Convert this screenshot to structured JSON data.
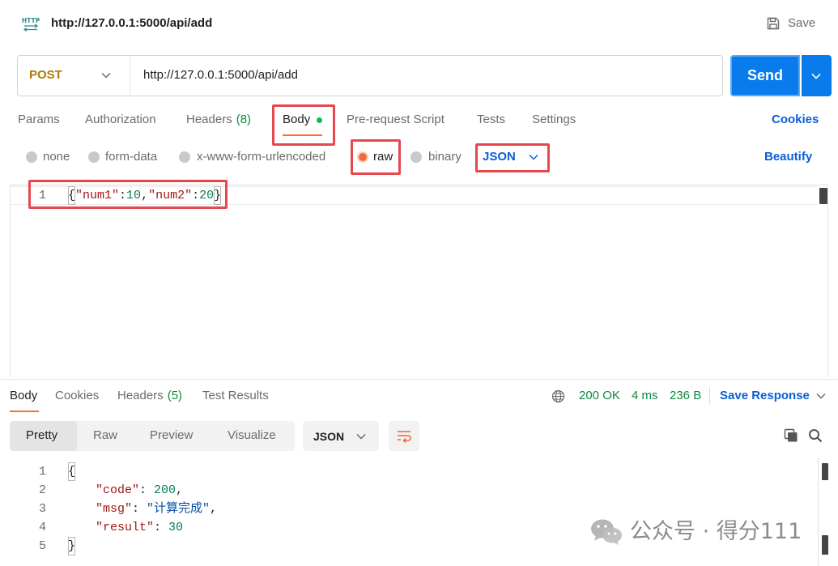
{
  "header": {
    "icon_text": "HTTP",
    "title": "http://127.0.0.1:5000/api/add",
    "save_label": "Save"
  },
  "request": {
    "method": "POST",
    "url": "http://127.0.0.1:5000/api/add",
    "send_label": "Send"
  },
  "request_tabs": [
    {
      "label": "Params",
      "active": false
    },
    {
      "label": "Authorization",
      "active": false
    },
    {
      "label": "Headers",
      "count": "(8)",
      "active": false
    },
    {
      "label": "Body",
      "active": true,
      "has_content": true
    },
    {
      "label": "Pre-request Script",
      "active": false
    },
    {
      "label": "Tests",
      "active": false
    },
    {
      "label": "Settings",
      "active": false
    }
  ],
  "cookies_label": "Cookies",
  "body_options": {
    "types": [
      {
        "label": "none",
        "selected": false
      },
      {
        "label": "form-data",
        "selected": false
      },
      {
        "label": "x-www-form-urlencoded",
        "selected": false
      },
      {
        "label": "raw",
        "selected": true
      },
      {
        "label": "binary",
        "selected": false
      }
    ],
    "format": "JSON",
    "beautify_label": "Beautify"
  },
  "request_body": {
    "line_numbers": [
      "1"
    ],
    "lines": [
      [
        "{",
        "\"num1\"",
        ":",
        "10",
        ",",
        "\"num2\"",
        ":",
        "20",
        "}"
      ]
    ]
  },
  "response_tabs": [
    {
      "label": "Body",
      "active": true
    },
    {
      "label": "Cookies",
      "active": false
    },
    {
      "label": "Headers",
      "count": "(5)",
      "active": false
    },
    {
      "label": "Test Results",
      "active": false
    }
  ],
  "response_meta": {
    "status": "200 OK",
    "time": "4 ms",
    "size": "236 B",
    "save_response_label": "Save Response"
  },
  "response_view": {
    "modes": [
      {
        "label": "Pretty",
        "selected": true
      },
      {
        "label": "Raw",
        "selected": false
      },
      {
        "label": "Preview",
        "selected": false
      },
      {
        "label": "Visualize",
        "selected": false
      }
    ],
    "format": "JSON"
  },
  "response_body": {
    "line_numbers": [
      "1",
      "2",
      "3",
      "4",
      "5"
    ],
    "lines": [
      [
        "{"
      ],
      [
        "\"code\"",
        ": ",
        "200",
        ","
      ],
      [
        "\"msg\"",
        ": ",
        "\"计算完成\"",
        ","
      ],
      [
        "\"result\"",
        ": ",
        "30"
      ],
      [
        "}"
      ]
    ]
  },
  "watermark": {
    "text": "公众号 · 得分111"
  },
  "icons": {
    "request_type": "http-icon",
    "save": "save-icon",
    "dropdown": "chevron-down-icon",
    "status": "globe-icon",
    "wrap": "wrap-lines-icon",
    "copy": "copy-icon",
    "search": "search-icon",
    "watermark": "wechat-icon"
  },
  "colors": {
    "send_button": "#097bed",
    "link": "#0b5ed7",
    "method_post": "#ad7a03",
    "success": "#0c8a3e",
    "active_tab_underline": "#ff6c37",
    "annotation_box": "#e5484d",
    "json_key": "#a31515",
    "json_number": "#0a7b5a",
    "json_string": "#0451a5"
  }
}
